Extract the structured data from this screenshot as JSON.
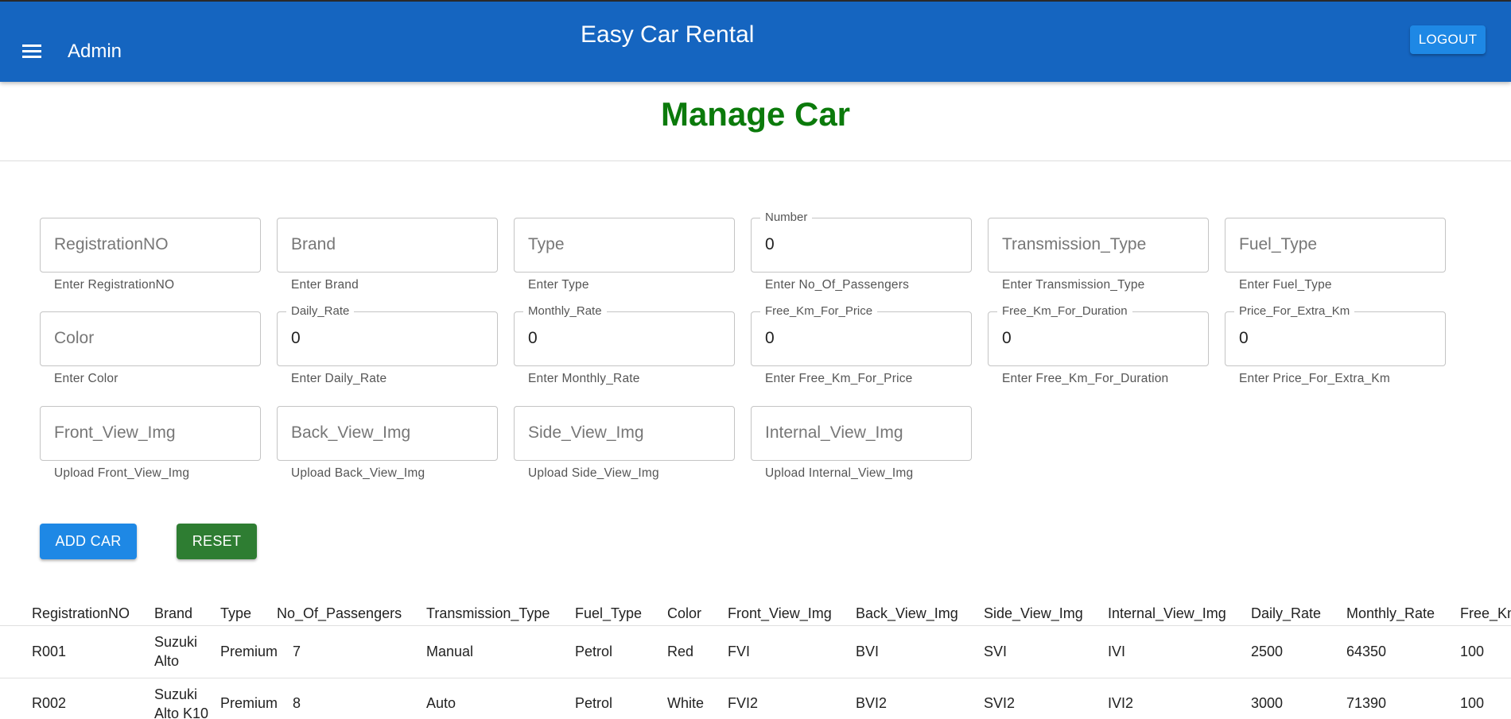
{
  "appbar": {
    "section_label": "Admin",
    "title": "Easy Car Rental",
    "logout_label": "LOGOUT",
    "menu_icon": "hamburger-menu-icon"
  },
  "page": {
    "title": "Manage Car"
  },
  "form": {
    "registration_no": {
      "placeholder": "RegistrationNO",
      "helper": "Enter RegistrationNO"
    },
    "brand": {
      "placeholder": "Brand",
      "helper": "Enter Brand"
    },
    "type": {
      "placeholder": "Type",
      "helper": "Enter Type"
    },
    "no_of_passengers": {
      "legend": "Number",
      "value": "0",
      "helper": "Enter No_Of_Passengers"
    },
    "transmission_type": {
      "placeholder": "Transmission_Type",
      "helper": "Enter Transmission_Type"
    },
    "fuel_type": {
      "placeholder": "Fuel_Type",
      "helper": "Enter Fuel_Type"
    },
    "color": {
      "placeholder": "Color",
      "helper": "Enter Color"
    },
    "daily_rate": {
      "legend": "Daily_Rate",
      "value": "0",
      "helper": "Enter Daily_Rate"
    },
    "monthly_rate": {
      "legend": "Monthly_Rate",
      "value": "0",
      "helper": "Enter Monthly_Rate"
    },
    "free_km_for_price": {
      "legend": "Free_Km_For_Price",
      "value": "0",
      "helper": "Enter Free_Km_For_Price"
    },
    "free_km_for_duration": {
      "legend": "Free_Km_For_Duration",
      "value": "0",
      "helper": "Enter Free_Km_For_Duration"
    },
    "price_for_extra_km": {
      "legend": "Price_For_Extra_Km",
      "value": "0",
      "helper": "Enter Price_For_Extra_Km"
    },
    "front_view_img": {
      "placeholder": "Front_View_Img",
      "helper": "Upload Front_View_Img"
    },
    "back_view_img": {
      "placeholder": "Back_View_Img",
      "helper": "Upload Back_View_Img"
    },
    "side_view_img": {
      "placeholder": "Side_View_Img",
      "helper": "Upload Side_View_Img"
    },
    "internal_view_img": {
      "placeholder": "Internal_View_Img",
      "helper": "Upload Internal_View_Img"
    },
    "add_label": "ADD CAR",
    "reset_label": "RESET"
  },
  "table": {
    "headers": [
      "RegistrationNO",
      "Brand",
      "Type",
      "No_Of_Passengers",
      "Transmission_Type",
      "Fuel_Type",
      "Color",
      "Front_View_Img",
      "Back_View_Img",
      "Side_View_Img",
      "Internal_View_Img",
      "Daily_Rate",
      "Monthly_Rate",
      "Free_Km"
    ],
    "rows": [
      [
        "R001",
        "Suzuki Alto",
        "Premium",
        "7",
        "Manual",
        "Petrol",
        "Red",
        "FVI",
        "BVI",
        "SVI",
        "IVI",
        "2500",
        "64350",
        "100"
      ],
      [
        "R002",
        "Suzuki Alto K10",
        "Premium",
        "8",
        "Auto",
        "Petrol",
        "White",
        "FVI2",
        "BVI2",
        "SVI2",
        "IVI2",
        "3000",
        "71390",
        "100"
      ]
    ]
  },
  "colors": {
    "appbar": "#1565c0",
    "primary_button": "#1e88e5",
    "reset_button": "#2e7d32",
    "title_green": "#0b7a0b"
  }
}
